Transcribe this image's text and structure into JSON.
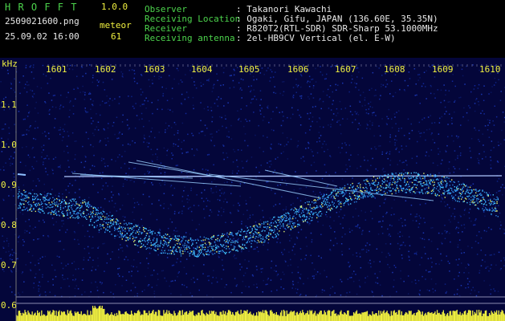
{
  "header": {
    "app_name": "H R O F F T",
    "version": "1.0.0",
    "filename": "2509021600.png",
    "datetime": "25.09.02 16:00",
    "meteor_label": "meteor",
    "meteor_count": "61"
  },
  "info": {
    "rows": [
      {
        "label": "Observer",
        "value": ": Takanori Kawachi"
      },
      {
        "label": "Receiving Location",
        "value": ": Ogaki, Gifu, JAPAN (136.60E, 35.35N)"
      },
      {
        "label": "Receiver",
        "value": ": R820T2(RTL-SDR) SDR-Sharp 53.1000MHz"
      },
      {
        "label": "Receiving antenna",
        "value": ": 2el-HB9CV Vertical (el. E-W)"
      }
    ]
  },
  "axis": {
    "y_unit": "kHz",
    "time_ticks": [
      "1601",
      "1602",
      "1603",
      "1604",
      "1605",
      "1606",
      "1607",
      "1608",
      "1609",
      "1610"
    ],
    "freq_ticks": [
      "1.1",
      "1.0",
      "0.9",
      "0.8",
      "0.7",
      "0.6"
    ]
  },
  "colors": {
    "label": "#4cd34c",
    "value": "#e8e8e8",
    "tick": "#f0f040",
    "background": "#04063a",
    "signal_bar": "#f0f040"
  }
}
